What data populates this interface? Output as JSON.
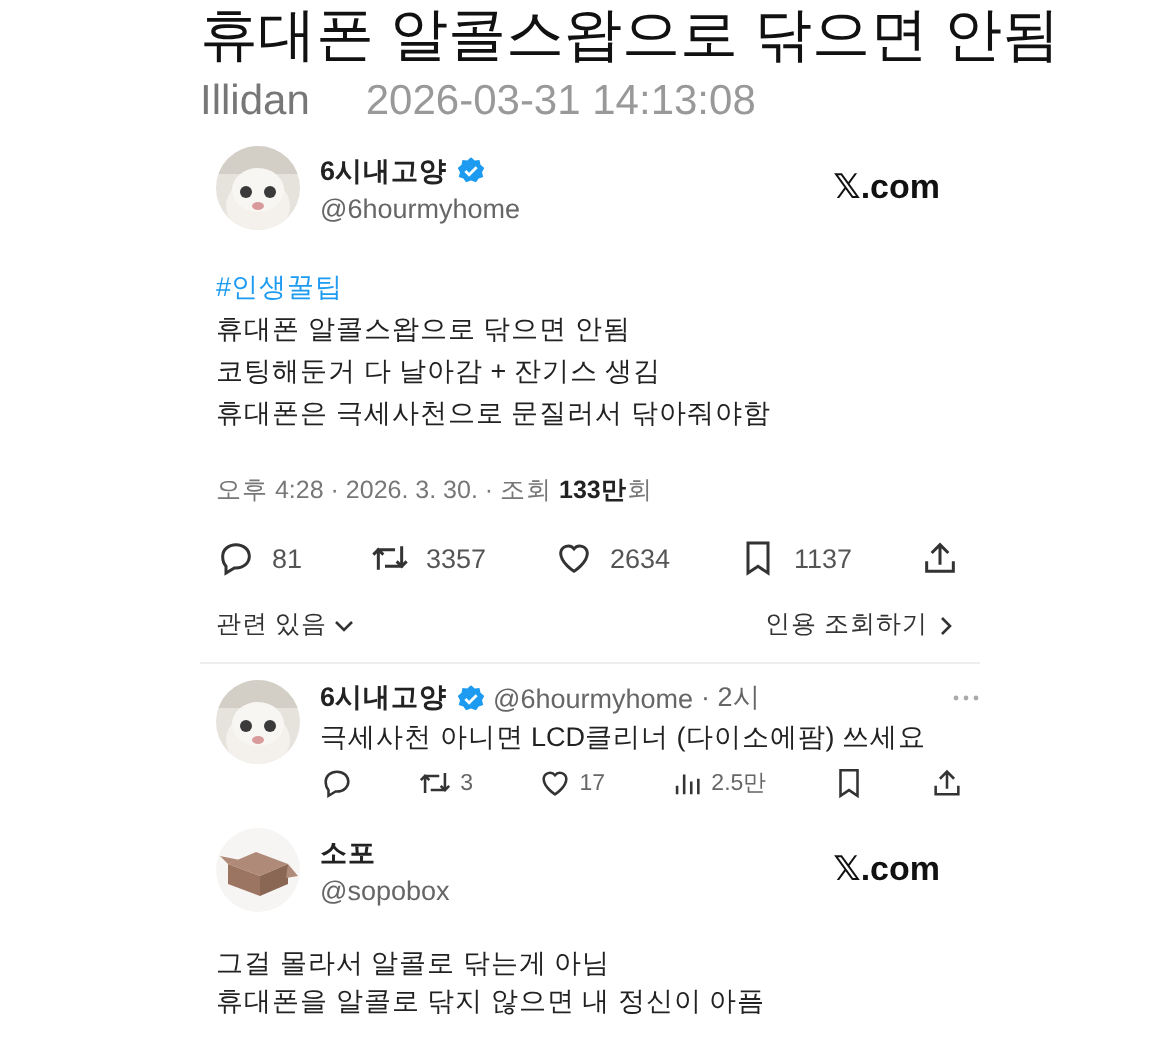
{
  "post": {
    "title": "휴대폰 알콜스왑으로 닦으면 안됨",
    "author": "Illidan",
    "datetime": "2026-03-31 14:13:08"
  },
  "tweet": {
    "name": "6시내고양",
    "verified": true,
    "handle": "@6hourmyhome",
    "site": "𝕏.com",
    "hashtag": "#인생꿀팁",
    "lines": [
      "휴대폰 알콜스왑으로 닦으면 안됨",
      "코팅해둔거 다 날아감 + 잔기스 생김",
      "휴대폰은 극세사천으로 문질러서 닦아줘야함"
    ],
    "meta": "오후 4:28 · 2026. 3. 30. · 조회 **133만**회",
    "actions": [
      {
        "kind": "reply",
        "count": "81"
      },
      {
        "kind": "retweet",
        "count": "3357"
      },
      {
        "kind": "like",
        "count": "2634"
      },
      {
        "kind": "bookmark",
        "count": "1137"
      },
      {
        "kind": "share"
      }
    ],
    "related": "관련 있음",
    "quotes": "인용 조회하기"
  },
  "reply": {
    "name": "6시내고양",
    "verified": true,
    "handle": "@6hourmyhome",
    "age": "· 2시",
    "text": "극세사천 아니면 LCD클리너 (다이소에팜) 쓰세요",
    "actions": [
      {
        "kind": "reply"
      },
      {
        "kind": "retweet",
        "count": "3"
      },
      {
        "kind": "like",
        "count": "17"
      },
      {
        "kind": "views",
        "count": "2.5만"
      },
      {
        "kind": "bookmark"
      },
      {
        "kind": "share"
      }
    ]
  },
  "tweet2": {
    "name": "소포",
    "handle": "@sopobox",
    "site": "𝕏.com",
    "lines": [
      "그걸 몰라서 알콜로 닦는게 아님",
      "휴대폰을 알콜로 닦지 않으면 내 정신이 아픔"
    ]
  }
}
